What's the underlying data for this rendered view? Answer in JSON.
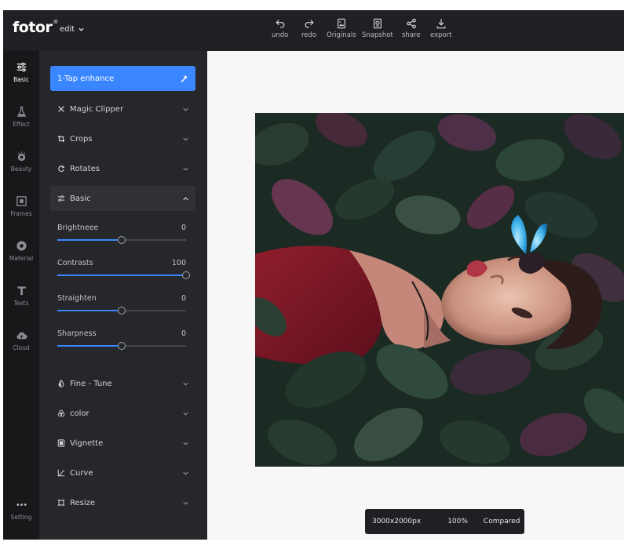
{
  "header": {
    "logo": "fotor",
    "logo_mark": "®",
    "edit_menu": "edit",
    "tools": [
      {
        "label": "undo",
        "icon": "undo-icon"
      },
      {
        "label": "redo",
        "icon": "redo-icon"
      },
      {
        "label": "Originals",
        "icon": "originals-icon"
      },
      {
        "label": "Snapshot",
        "icon": "snapshot-icon"
      },
      {
        "label": "share",
        "icon": "share-icon"
      },
      {
        "label": "export",
        "icon": "export-icon"
      }
    ]
  },
  "rail": {
    "items": [
      {
        "label": "Basic",
        "icon": "sliders-icon",
        "active": true
      },
      {
        "label": "Effect",
        "icon": "flask-icon"
      },
      {
        "label": "Beauty",
        "icon": "beauty-icon"
      },
      {
        "label": "Frames",
        "icon": "frame-icon"
      },
      {
        "label": "Material",
        "icon": "material-icon"
      },
      {
        "label": "Texts",
        "icon": "text-icon"
      },
      {
        "label": "Cloud",
        "icon": "cloud-icon"
      },
      {
        "label": "Setting",
        "icon": "more-icon"
      }
    ]
  },
  "panel": {
    "enhance_label": "1-Tap enhance",
    "sections_top": [
      {
        "label": "Magic Clipper",
        "icon": "clipper-icon"
      },
      {
        "label": "Crops",
        "icon": "crop-icon"
      },
      {
        "label": "Rotates",
        "icon": "rotate-icon"
      }
    ],
    "basic": {
      "label": "Basic",
      "icon": "sliders-icon",
      "expanded": true
    },
    "sliders": [
      {
        "label": "Brightneee",
        "value": "0",
        "level": 0.5
      },
      {
        "label": "Contrasts",
        "value": "100",
        "level": 1.0
      },
      {
        "label": "Straighten",
        "value": "0",
        "level": 0.5
      },
      {
        "label": "Sharpness",
        "value": "0",
        "level": 0.5
      }
    ],
    "sections_bottom": [
      {
        "label": "Fine - Tune",
        "icon": "droplet-icon"
      },
      {
        "label": "color",
        "icon": "color-icon"
      },
      {
        "label": "Vignette",
        "icon": "vignette-icon"
      },
      {
        "label": "Curve",
        "icon": "curve-icon"
      },
      {
        "label": "Resize",
        "icon": "resize-icon"
      }
    ]
  },
  "canvas": {
    "image_size": "3000x2000px",
    "zoom": "100%",
    "compare_label": "Compared"
  },
  "colors": {
    "accent": "#3a86ff",
    "topbar": "#1f2023",
    "rail": "#17181a",
    "panel": "#26272b",
    "canvas_bg": "#f7f7f8"
  }
}
